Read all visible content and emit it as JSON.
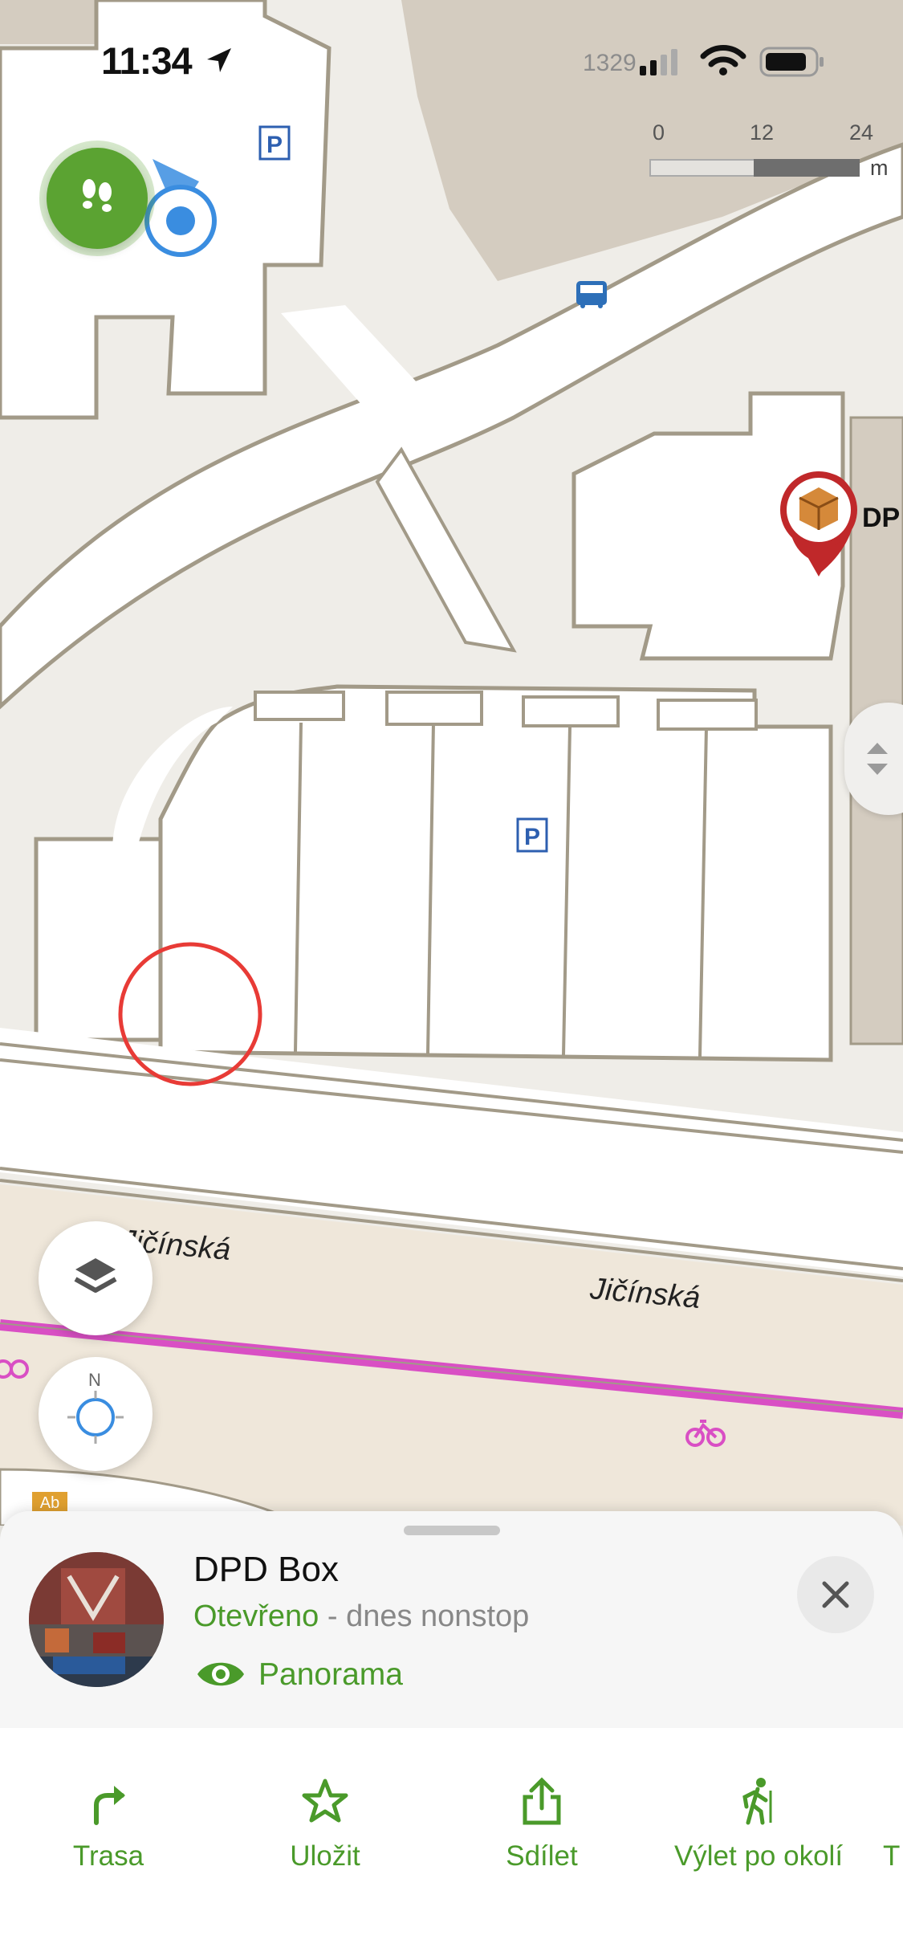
{
  "status_bar": {
    "time": "11:34",
    "carrier_text": "1329"
  },
  "map": {
    "scale": {
      "labels": [
        "0",
        "12",
        "24"
      ],
      "unit": "m"
    },
    "streets": [
      "Jičínská",
      "Jičínská"
    ],
    "poi_label": "DP",
    "colors": {
      "building": "#ffffff",
      "ground": "#efede8",
      "outline": "#a29a88",
      "dark_area": "#d4ccc0",
      "bike_route": "#d94fc4",
      "accent": "#4a9a2a",
      "pin": "#c0282a"
    }
  },
  "compass": {
    "north": "N"
  },
  "bottom_sheet": {
    "title": "DPD Box",
    "status_open": "Otevřeno",
    "status_rest": " - dnes nonstop",
    "panorama": "Panorama"
  },
  "actions": [
    {
      "label": "Trasa",
      "icon": "route-icon"
    },
    {
      "label": "Uložit",
      "icon": "star-icon"
    },
    {
      "label": "Sdílet",
      "icon": "share-icon"
    },
    {
      "label": "Výlet po okolí",
      "icon": "hiker-icon"
    },
    {
      "label": "T",
      "icon": ""
    }
  ]
}
